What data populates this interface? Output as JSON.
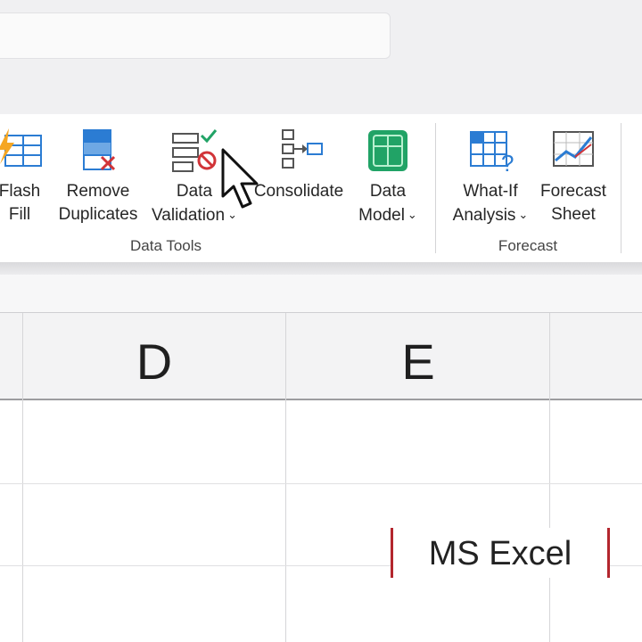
{
  "ribbon": {
    "commands": {
      "flash_fill": "Flash\nFill",
      "remove_duplicates": "Remove\nDuplicates",
      "data_validation_1": "Data",
      "data_validation_2": "Validation",
      "consolidate": "Consolidate",
      "data_model_1": "Data",
      "data_model_2": "Model",
      "what_if_1": "What-If",
      "what_if_2": "Analysis",
      "forecast_sheet_1": "Forecast",
      "forecast_sheet_2": "Sheet",
      "flash_1": "Flash",
      "flash_2": "Fill",
      "remove_1": "Remove",
      "remove_2": "Duplicates"
    },
    "groups": {
      "data_tools": "Data Tools",
      "forecast": "Forecast"
    },
    "chevron": "⌄"
  },
  "sheet": {
    "columns": [
      "D",
      "E"
    ]
  },
  "watermark": "MS Excel",
  "icons": [
    "flash-fill-icon",
    "remove-duplicates-icon",
    "data-validation-icon",
    "consolidate-icon",
    "data-model-icon",
    "what-if-analysis-icon",
    "forecast-sheet-icon",
    "mouse-pointer-icon"
  ],
  "colors": {
    "accent_red": "#b3262d",
    "excel_green": "#21a366",
    "icon_blue": "#2b7cd3"
  }
}
